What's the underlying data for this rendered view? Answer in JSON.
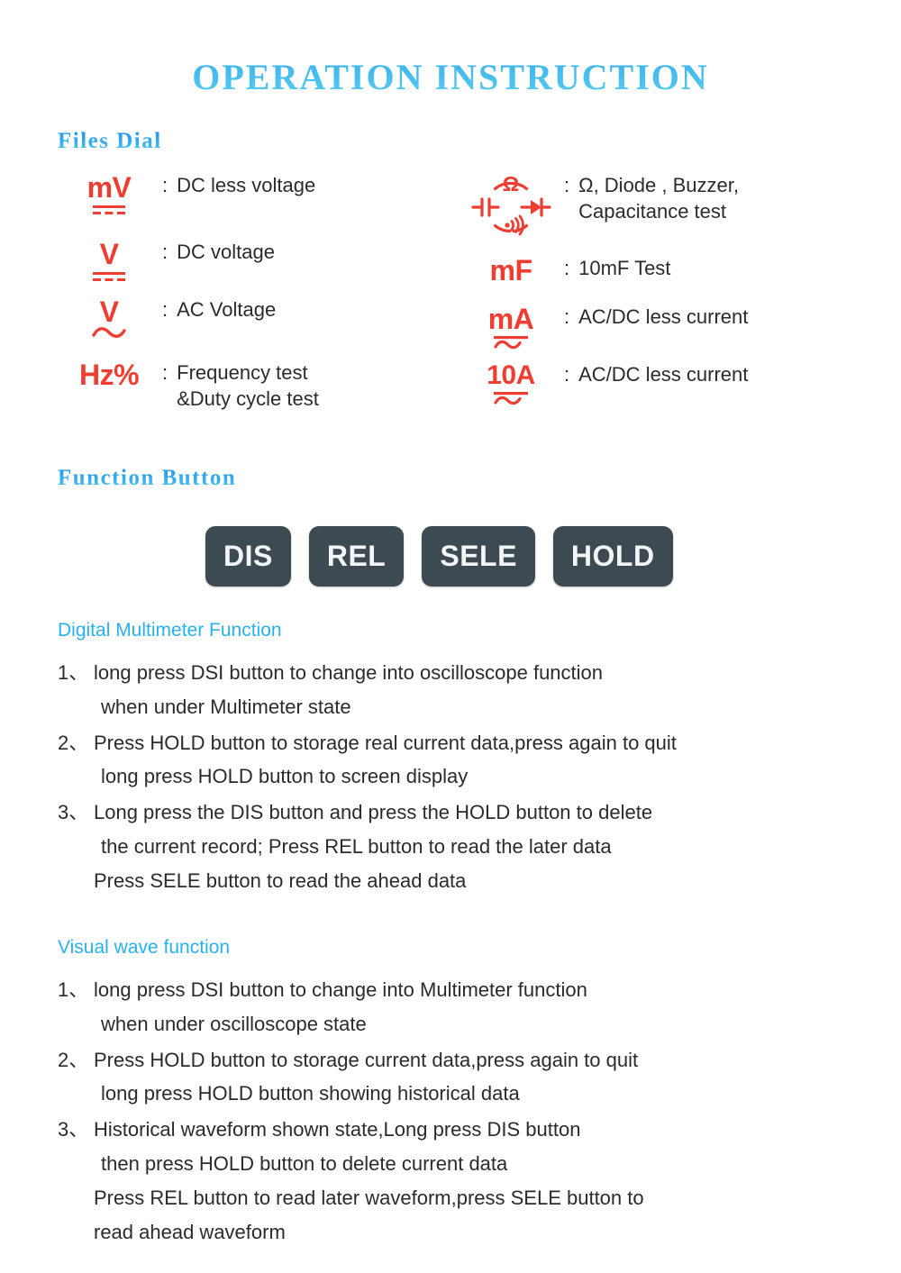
{
  "title": "OPERATION INSTRUCTION",
  "colors": {
    "title_blue_top": "#1f90e8",
    "title_blue_bottom": "#57cdf2",
    "heading_blue": "#29b1ee",
    "symbol_red": "#ee3d31",
    "button_bg": "#3e4a52",
    "button_text": "#f2f6f7",
    "body_text": "#2b2b2b"
  },
  "files_dial": {
    "heading": "Files  Dial",
    "separator": ":",
    "left_items": [
      {
        "symbol_text": "mV",
        "symbol_marker": "dc",
        "icon": "dc-millivolt-icon",
        "description": "DC less voltage"
      },
      {
        "symbol_text": "V",
        "symbol_marker": "dc",
        "icon": "dc-volt-icon",
        "description": "DC voltage"
      },
      {
        "symbol_text": "V",
        "symbol_marker": "ac",
        "icon": "ac-volt-icon",
        "description": "AC Voltage"
      },
      {
        "symbol_text": "Hz%",
        "symbol_marker": "none",
        "icon": "frequency-duty-icon",
        "description": "Frequency test\n&Duty cycle test"
      }
    ],
    "right_items": [
      {
        "symbol_text": "",
        "symbol_marker": "ohm-diode-buzzer-cap",
        "icon": "ohm-diode-buzzer-capacitance-icon",
        "description": "Ω, Diode , Buzzer,\nCapacitance test"
      },
      {
        "symbol_text": "mF",
        "symbol_marker": "none",
        "icon": "millifarad-icon",
        "description": "10mF Test"
      },
      {
        "symbol_text": "mA",
        "symbol_marker": "acdc",
        "icon": "acdc-milliamp-icon",
        "description": "AC/DC less current"
      },
      {
        "symbol_text": "10A",
        "symbol_marker": "acdc",
        "icon": "acdc-10amp-icon",
        "description": "AC/DC less current"
      }
    ]
  },
  "function_button": {
    "heading": "Function  Button",
    "buttons": [
      {
        "label": "DIS"
      },
      {
        "label": "REL"
      },
      {
        "label": "SELE"
      },
      {
        "label": "HOLD"
      }
    ]
  },
  "digital_multimeter": {
    "heading": "Digital Multimeter Function",
    "items": [
      {
        "number": "1、",
        "lines": [
          "long press DSI button to change into oscilloscope function",
          "when under Multimeter state"
        ]
      },
      {
        "number": "2、",
        "lines": [
          "Press HOLD button to storage real current data,press again to quit",
          "long press HOLD button to screen display"
        ]
      },
      {
        "number": "3、",
        "lines": [
          "Long press the DIS button and press the HOLD button to delete",
          "the current record; Press REL button to read the later data",
          "Press SELE button to read the ahead data"
        ]
      }
    ]
  },
  "visual_wave": {
    "heading": "Visual wave function",
    "items": [
      {
        "number": "1、",
        "lines": [
          "long press DSI button to change into Multimeter function",
          "when under oscilloscope state"
        ]
      },
      {
        "number": "2、",
        "lines": [
          "Press HOLD button to storage current data,press again to quit",
          "long press HOLD button showing historical data"
        ]
      },
      {
        "number": "3、",
        "lines": [
          "Historical waveform shown state,Long press DIS button",
          "then press HOLD button to delete current data",
          "Press REL button to read later waveform,press SELE button to",
          "read ahead waveform"
        ]
      }
    ]
  }
}
